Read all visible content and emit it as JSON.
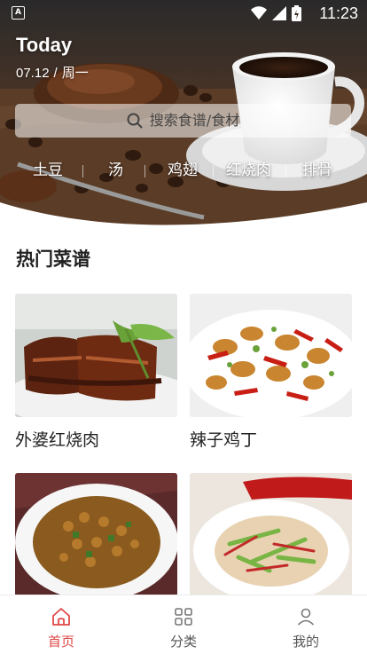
{
  "status_bar": {
    "app_icon": "A",
    "time": "11:23",
    "icons": [
      "wifi-icon",
      "signal-icon",
      "battery-icon"
    ]
  },
  "header": {
    "today_label": "Today",
    "date": "07.12",
    "date_separator": "/",
    "weekday": "周一"
  },
  "search": {
    "placeholder": "搜索食谱/食材",
    "icon": "search-icon"
  },
  "tags": [
    "土豆",
    "汤",
    "鸡翅",
    "红烧肉",
    "排骨"
  ],
  "section": {
    "title": "热门菜谱"
  },
  "recipes": [
    {
      "name": "外婆红烧肉"
    },
    {
      "name": "辣子鸡丁"
    },
    {
      "name": ""
    },
    {
      "name": ""
    }
  ],
  "bottom_nav": {
    "items": [
      {
        "label": "首页",
        "icon": "home-icon",
        "active": true
      },
      {
        "label": "分类",
        "icon": "grid-icon",
        "active": false
      },
      {
        "label": "我的",
        "icon": "user-icon",
        "active": false
      }
    ]
  },
  "colors": {
    "accent": "#e04848",
    "nav_inactive": "#555555",
    "hero_dark": "#2b1c14"
  }
}
